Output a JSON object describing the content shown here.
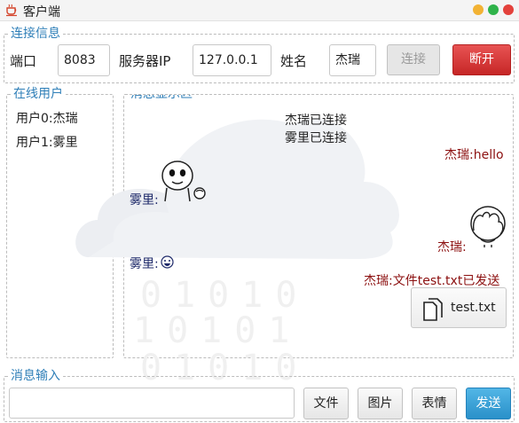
{
  "window": {
    "title": "客户端"
  },
  "connection": {
    "legend": "连接信息",
    "port_label": "端口",
    "port_value": "8083",
    "server_label": "服务器IP",
    "server_value": "127.0.0.1",
    "name_label": "姓名",
    "name_value": "杰瑞",
    "connect_label": "连接",
    "disconnect_label": "断开"
  },
  "online": {
    "legend": "在线用户",
    "users": [
      "用户0:杰瑞",
      "用户1:雾里"
    ]
  },
  "messages": {
    "legend": "消息显示区",
    "items": [
      {
        "type": "system",
        "text": "杰瑞已连接"
      },
      {
        "type": "system",
        "text": "雾里已连接"
      },
      {
        "type": "mine",
        "text": "杰瑞:hello"
      },
      {
        "type": "other",
        "text": "雾里:",
        "attachment": "sticker-image"
      },
      {
        "type": "mine",
        "text": "杰瑞:",
        "attachment": "sticker-image"
      },
      {
        "type": "other",
        "text": "雾里:",
        "attachment": "smiley-emoji"
      },
      {
        "type": "mine",
        "text": "杰瑞:文件test.txt已发送"
      }
    ],
    "file_card": {
      "name": "test.txt",
      "icon": "file-icon"
    }
  },
  "input": {
    "legend": "消息输入",
    "value": "",
    "file_label": "文件",
    "image_label": "图片",
    "emoji_label": "表情",
    "send_label": "发送"
  },
  "colors": {
    "legend": "#2f7fb8",
    "my_message": "#8c1010",
    "other_message": "#1e2a6a",
    "disconnect": "#d23b3b",
    "send": "#3ba1d8"
  }
}
